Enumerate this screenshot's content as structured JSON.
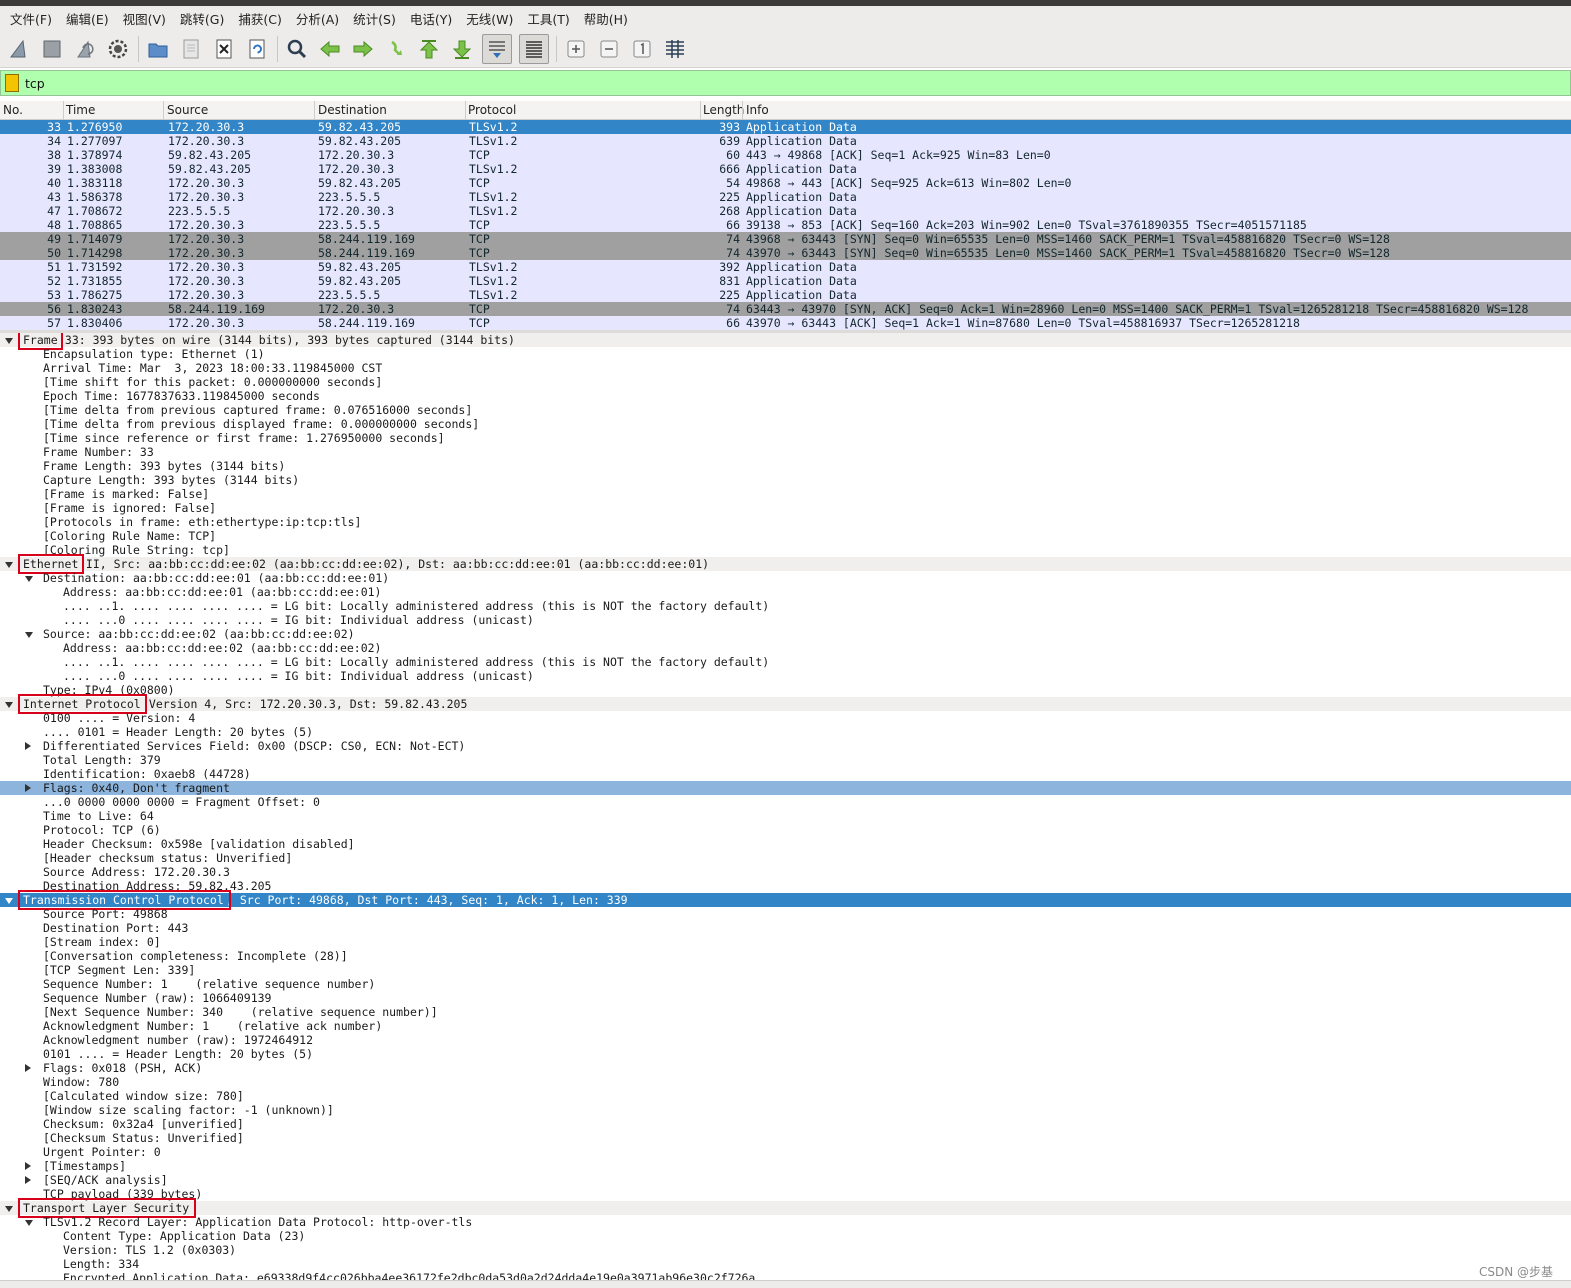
{
  "menu": [
    "文件(F)",
    "编辑(E)",
    "视图(V)",
    "跳转(G)",
    "捕获(C)",
    "分析(A)",
    "统计(S)",
    "电话(Y)",
    "无线(W)",
    "工具(T)",
    "帮助(H)"
  ],
  "toolbar": {
    "icons": [
      "shark-fin-start-icon",
      "stop-square-icon",
      "restart-fin-icon",
      "capture-options-gear-icon",
      "open-folder-icon",
      "save-file-icon",
      "close-file-icon",
      "reload-file-icon",
      "find-magnifier-icon",
      "go-back-arrow-icon",
      "go-forward-arrow-icon",
      "go-to-packet-icon",
      "go-first-packet-icon",
      "go-last-packet-icon",
      "auto-scroll-icon",
      "colorize-icon",
      "zoom-in-icon",
      "zoom-out-icon",
      "normal-size-icon",
      "resize-columns-icon"
    ]
  },
  "filter": {
    "value": "tcp"
  },
  "columns": [
    "No.",
    "Time",
    "Source",
    "Destination",
    "Protocol",
    "Length",
    "Info"
  ],
  "packets": [
    {
      "no": "33",
      "time": "1.276950",
      "src": "172.20.30.3",
      "dst": "59.82.43.205",
      "proto": "TLSv1.2",
      "len": "393",
      "info": "Application Data",
      "style": "sel"
    },
    {
      "no": "34",
      "time": "1.277097",
      "src": "172.20.30.3",
      "dst": "59.82.43.205",
      "proto": "TLSv1.2",
      "len": "639",
      "info": "Application Data",
      "style": "tcp"
    },
    {
      "no": "38",
      "time": "1.378974",
      "src": "59.82.43.205",
      "dst": "172.20.30.3",
      "proto": "TCP",
      "len": "60",
      "info": "443 → 49868 [ACK] Seq=1 Ack=925 Win=83 Len=0",
      "style": "tcp"
    },
    {
      "no": "39",
      "time": "1.383008",
      "src": "59.82.43.205",
      "dst": "172.20.30.3",
      "proto": "TLSv1.2",
      "len": "666",
      "info": "Application Data",
      "style": "tcp"
    },
    {
      "no": "40",
      "time": "1.383118",
      "src": "172.20.30.3",
      "dst": "59.82.43.205",
      "proto": "TCP",
      "len": "54",
      "info": "49868 → 443 [ACK] Seq=925 Ack=613 Win=802 Len=0",
      "style": "tcp"
    },
    {
      "no": "43",
      "time": "1.586378",
      "src": "172.20.30.3",
      "dst": "223.5.5.5",
      "proto": "TLSv1.2",
      "len": "225",
      "info": "Application Data",
      "style": "tcp"
    },
    {
      "no": "47",
      "time": "1.708672",
      "src": "223.5.5.5",
      "dst": "172.20.30.3",
      "proto": "TLSv1.2",
      "len": "268",
      "info": "Application Data",
      "style": "tcp"
    },
    {
      "no": "48",
      "time": "1.708865",
      "src": "172.20.30.3",
      "dst": "223.5.5.5",
      "proto": "TCP",
      "len": "66",
      "info": "39138 → 853 [ACK] Seq=160 Ack=203 Win=902 Len=0 TSval=3761890355 TSecr=4051571185",
      "style": "tcp"
    },
    {
      "no": "49",
      "time": "1.714079",
      "src": "172.20.30.3",
      "dst": "58.244.119.169",
      "proto": "TCP",
      "len": "74",
      "info": "43968 → 63443 [SYN] Seq=0 Win=65535 Len=0 MSS=1460 SACK_PERM=1 TSval=458816820 TSecr=0 WS=128",
      "style": "syn"
    },
    {
      "no": "50",
      "time": "1.714298",
      "src": "172.20.30.3",
      "dst": "58.244.119.169",
      "proto": "TCP",
      "len": "74",
      "info": "43970 → 63443 [SYN] Seq=0 Win=65535 Len=0 MSS=1460 SACK_PERM=1 TSval=458816820 TSecr=0 WS=128",
      "style": "syn"
    },
    {
      "no": "51",
      "time": "1.731592",
      "src": "172.20.30.3",
      "dst": "59.82.43.205",
      "proto": "TLSv1.2",
      "len": "392",
      "info": "Application Data",
      "style": "tcp"
    },
    {
      "no": "52",
      "time": "1.731855",
      "src": "172.20.30.3",
      "dst": "59.82.43.205",
      "proto": "TLSv1.2",
      "len": "831",
      "info": "Application Data",
      "style": "tcp"
    },
    {
      "no": "53",
      "time": "1.786275",
      "src": "172.20.30.3",
      "dst": "223.5.5.5",
      "proto": "TLSv1.2",
      "len": "225",
      "info": "Application Data",
      "style": "tcp"
    },
    {
      "no": "56",
      "time": "1.830243",
      "src": "58.244.119.169",
      "dst": "172.20.30.3",
      "proto": "TCP",
      "len": "74",
      "info": "63443 → 43970 [SYN, ACK] Seq=0 Ack=1 Win=28960 Len=0 MSS=1400 SACK_PERM=1 TSval=1265281218 TSecr=458816820 WS=128",
      "style": "syn"
    },
    {
      "no": "57",
      "time": "1.830406",
      "src": "172.20.30.3",
      "dst": "58.244.119.169",
      "proto": "TCP",
      "len": "66",
      "info": "43970 → 63443 [ACK] Seq=1 Ack=1 Win=87680 Len=0 TSval=458816937 TSecr=1265281218",
      "style": "tcp"
    }
  ],
  "details": [
    {
      "indent": 0,
      "tw": "down",
      "style": "hdr",
      "label": "Frame",
      "rest": " 33: 393 bytes on wire (3144 bits), 393 bytes captured (3144 bits)",
      "boxed": true
    },
    {
      "indent": 1,
      "tw": "",
      "label": "Encapsulation type: Ethernet (1)"
    },
    {
      "indent": 1,
      "tw": "",
      "label": "Arrival Time: Mar  3, 2023 18:00:33.119845000 CST"
    },
    {
      "indent": 1,
      "tw": "",
      "label": "[Time shift for this packet: 0.000000000 seconds]"
    },
    {
      "indent": 1,
      "tw": "",
      "label": "Epoch Time: 1677837633.119845000 seconds"
    },
    {
      "indent": 1,
      "tw": "",
      "label": "[Time delta from previous captured frame: 0.076516000 seconds]"
    },
    {
      "indent": 1,
      "tw": "",
      "label": "[Time delta from previous displayed frame: 0.000000000 seconds]"
    },
    {
      "indent": 1,
      "tw": "",
      "label": "[Time since reference or first frame: 1.276950000 seconds]"
    },
    {
      "indent": 1,
      "tw": "",
      "label": "Frame Number: 33"
    },
    {
      "indent": 1,
      "tw": "",
      "label": "Frame Length: 393 bytes (3144 bits)"
    },
    {
      "indent": 1,
      "tw": "",
      "label": "Capture Length: 393 bytes (3144 bits)"
    },
    {
      "indent": 1,
      "tw": "",
      "label": "[Frame is marked: False]"
    },
    {
      "indent": 1,
      "tw": "",
      "label": "[Frame is ignored: False]"
    },
    {
      "indent": 1,
      "tw": "",
      "label": "[Protocols in frame: eth:ethertype:ip:tcp:tls]"
    },
    {
      "indent": 1,
      "tw": "",
      "label": "[Coloring Rule Name: TCP]"
    },
    {
      "indent": 1,
      "tw": "",
      "label": "[Coloring Rule String: tcp]"
    },
    {
      "indent": 0,
      "tw": "down",
      "style": "hdr",
      "label": "Ethernet",
      "rest": " II, Src: aa:bb:cc:dd:ee:02 (aa:bb:cc:dd:ee:02), Dst: aa:bb:cc:dd:ee:01 (aa:bb:cc:dd:ee:01)",
      "boxed": true
    },
    {
      "indent": 1,
      "tw": "down",
      "label": "Destination: aa:bb:cc:dd:ee:01 (aa:bb:cc:dd:ee:01)"
    },
    {
      "indent": 2,
      "tw": "",
      "label": "Address: aa:bb:cc:dd:ee:01 (aa:bb:cc:dd:ee:01)"
    },
    {
      "indent": 2,
      "tw": "",
      "label": ".... ..1. .... .... .... .... = LG bit: Locally administered address (this is NOT the factory default)"
    },
    {
      "indent": 2,
      "tw": "",
      "label": ".... ...0 .... .... .... .... = IG bit: Individual address (unicast)"
    },
    {
      "indent": 1,
      "tw": "down",
      "label": "Source: aa:bb:cc:dd:ee:02 (aa:bb:cc:dd:ee:02)"
    },
    {
      "indent": 2,
      "tw": "",
      "label": "Address: aa:bb:cc:dd:ee:02 (aa:bb:cc:dd:ee:02)"
    },
    {
      "indent": 2,
      "tw": "",
      "label": ".... ..1. .... .... .... .... = LG bit: Locally administered address (this is NOT the factory default)"
    },
    {
      "indent": 2,
      "tw": "",
      "label": ".... ...0 .... .... .... .... = IG bit: Individual address (unicast)"
    },
    {
      "indent": 1,
      "tw": "",
      "label": "Type: IPv4 (0x0800)"
    },
    {
      "indent": 0,
      "tw": "down",
      "style": "hdr",
      "label": "Internet Protocol",
      "rest": " Version 4, Src: 172.20.30.3, Dst: 59.82.43.205",
      "boxed": true
    },
    {
      "indent": 1,
      "tw": "",
      "label": "0100 .... = Version: 4"
    },
    {
      "indent": 1,
      "tw": "",
      "label": ".... 0101 = Header Length: 20 bytes (5)"
    },
    {
      "indent": 1,
      "tw": "right",
      "label": "Differentiated Services Field: 0x00 (DSCP: CS0, ECN: Not-ECT)"
    },
    {
      "indent": 1,
      "tw": "",
      "label": "Total Length: 379"
    },
    {
      "indent": 1,
      "tw": "",
      "label": "Identification: 0xaeb8 (44728)"
    },
    {
      "indent": 1,
      "tw": "right",
      "style": "hl",
      "label": "Flags: 0x40, Don't fragment"
    },
    {
      "indent": 1,
      "tw": "",
      "label": "...0 0000 0000 0000 = Fragment Offset: 0"
    },
    {
      "indent": 1,
      "tw": "",
      "label": "Time to Live: 64"
    },
    {
      "indent": 1,
      "tw": "",
      "label": "Protocol: TCP (6)"
    },
    {
      "indent": 1,
      "tw": "",
      "label": "Header Checksum: 0x598e [validation disabled]"
    },
    {
      "indent": 1,
      "tw": "",
      "label": "[Header checksum status: Unverified]"
    },
    {
      "indent": 1,
      "tw": "",
      "label": "Source Address: 172.20.30.3"
    },
    {
      "indent": 1,
      "tw": "",
      "label": "Destination Address: 59.82.43.205"
    },
    {
      "indent": 0,
      "tw": "down",
      "style": "sel",
      "label": "Transmission Control Protocol",
      "rest": ", Src Port: 49868, Dst Port: 443, Seq: 1, Ack: 1, Len: 339",
      "boxed": true
    },
    {
      "indent": 1,
      "tw": "",
      "label": "Source Port: 49868"
    },
    {
      "indent": 1,
      "tw": "",
      "label": "Destination Port: 443"
    },
    {
      "indent": 1,
      "tw": "",
      "label": "[Stream index: 0]"
    },
    {
      "indent": 1,
      "tw": "",
      "label": "[Conversation completeness: Incomplete (28)]"
    },
    {
      "indent": 1,
      "tw": "",
      "label": "[TCP Segment Len: 339]"
    },
    {
      "indent": 1,
      "tw": "",
      "label": "Sequence Number: 1    (relative sequence number)"
    },
    {
      "indent": 1,
      "tw": "",
      "label": "Sequence Number (raw): 1066409139"
    },
    {
      "indent": 1,
      "tw": "",
      "label": "[Next Sequence Number: 340    (relative sequence number)]"
    },
    {
      "indent": 1,
      "tw": "",
      "label": "Acknowledgment Number: 1    (relative ack number)"
    },
    {
      "indent": 1,
      "tw": "",
      "label": "Acknowledgment number (raw): 1972464912"
    },
    {
      "indent": 1,
      "tw": "",
      "label": "0101 .... = Header Length: 20 bytes (5)"
    },
    {
      "indent": 1,
      "tw": "right",
      "label": "Flags: 0x018 (PSH, ACK)"
    },
    {
      "indent": 1,
      "tw": "",
      "label": "Window: 780"
    },
    {
      "indent": 1,
      "tw": "",
      "label": "[Calculated window size: 780]"
    },
    {
      "indent": 1,
      "tw": "",
      "label": "[Window size scaling factor: -1 (unknown)]"
    },
    {
      "indent": 1,
      "tw": "",
      "label": "Checksum: 0x32a4 [unverified]"
    },
    {
      "indent": 1,
      "tw": "",
      "label": "[Checksum Status: Unverified]"
    },
    {
      "indent": 1,
      "tw": "",
      "label": "Urgent Pointer: 0"
    },
    {
      "indent": 1,
      "tw": "right",
      "label": "[Timestamps]"
    },
    {
      "indent": 1,
      "tw": "right",
      "label": "[SEQ/ACK analysis]"
    },
    {
      "indent": 1,
      "tw": "",
      "label": "TCP payload (339 bytes)"
    },
    {
      "indent": 0,
      "tw": "down",
      "style": "hdr",
      "label": "Transport Layer Security",
      "rest": "",
      "boxed": true
    },
    {
      "indent": 1,
      "tw": "down",
      "label": "TLSv1.2 Record Layer: Application Data Protocol: http-over-tls"
    },
    {
      "indent": 2,
      "tw": "",
      "label": "Content Type: Application Data (23)"
    },
    {
      "indent": 2,
      "tw": "",
      "label": "Version: TLS 1.2 (0x0303)"
    },
    {
      "indent": 2,
      "tw": "",
      "label": "Length: 334"
    },
    {
      "indent": 2,
      "tw": "",
      "label": "Encrypted Application Data: e69338d9f4cc026bba4ee36172fe2dbc0da53d0a2d24dda4e19e0a3971ab96e30c2f726a"
    }
  ],
  "watermark": "CSDN @步基"
}
